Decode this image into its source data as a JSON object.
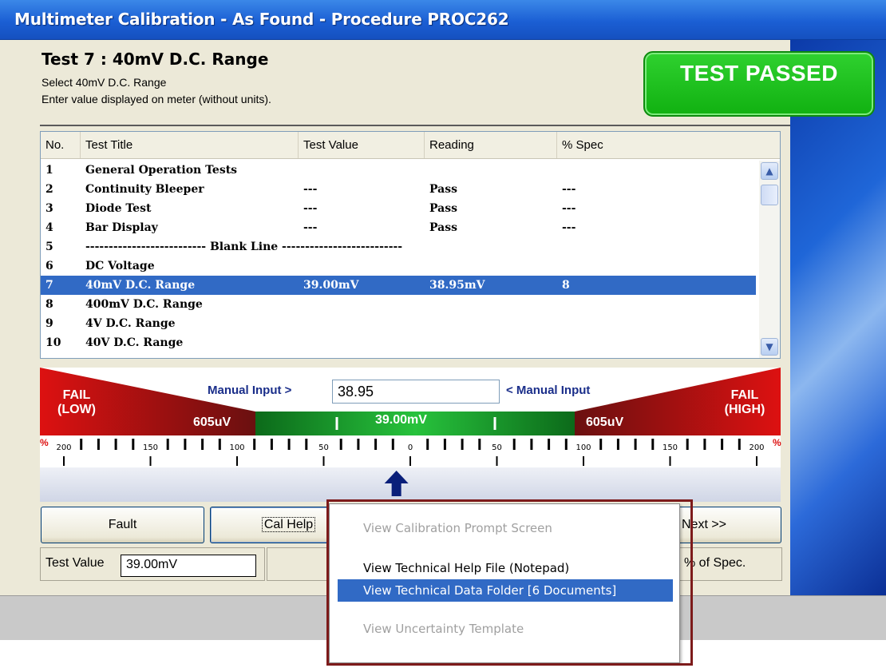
{
  "window": {
    "title": "Multimeter Calibration - As Found - Procedure PROC262"
  },
  "test": {
    "heading": "Test 7 : 40mV D.C. Range",
    "instruction1": "Select 40mV D.C. Range",
    "instruction2": "Enter value displayed on meter (without units).",
    "status": "TEST PASSED"
  },
  "table": {
    "headers": [
      "No.",
      "Test Title",
      "Test Value",
      "Reading",
      "% Spec"
    ],
    "rows": [
      {
        "no": "1",
        "title": "General Operation Tests",
        "value": "",
        "reading": "",
        "spec": ""
      },
      {
        "no": "2",
        "title": "Continuity Bleeper",
        "value": "---",
        "reading": "Pass",
        "spec": "---"
      },
      {
        "no": "3",
        "title": "Diode Test",
        "value": "---",
        "reading": "Pass",
        "spec": "---"
      },
      {
        "no": "4",
        "title": "Bar Display",
        "value": "---",
        "reading": "Pass",
        "spec": "---"
      },
      {
        "no": "5",
        "title": "-------------------------- Blank Line --------------------------",
        "value": "",
        "reading": "",
        "spec": ""
      },
      {
        "no": "6",
        "title": "DC Voltage",
        "value": "",
        "reading": "",
        "spec": ""
      },
      {
        "no": "7",
        "title": "40mV D.C. Range",
        "value": "39.00mV",
        "reading": "38.95mV",
        "spec": "8"
      },
      {
        "no": "8",
        "title": "400mV D.C. Range",
        "value": "",
        "reading": "",
        "spec": ""
      },
      {
        "no": "9",
        "title": "4V D.C. Range",
        "value": "",
        "reading": "",
        "spec": ""
      },
      {
        "no": "10",
        "title": "40V D.C. Range",
        "value": "",
        "reading": "",
        "spec": ""
      }
    ],
    "selected_index": 6
  },
  "gauge": {
    "fail_low_1": "FAIL",
    "fail_low_2": "(LOW)",
    "fail_high_1": "FAIL",
    "fail_high_2": "(HIGH)",
    "tol_low": "605uV",
    "tol_high": "605uV",
    "nominal": "39.00mV",
    "manual_input_left": "Manual Input >",
    "manual_input_right": "< Manual Input",
    "manual_input_value": "38.95",
    "scale_labels": [
      "200",
      "150",
      "100",
      "50",
      "0",
      "50",
      "100",
      "150",
      "200"
    ],
    "end_label_left": "%",
    "end_label_right": "%",
    "pointer_percent": -8
  },
  "buttons": {
    "fault": "Fault",
    "cal_help": "Cal Help",
    "next": "Next >>"
  },
  "status": {
    "test_value_label": "Test Value",
    "test_value": "39.00mV",
    "spec_label": "% of Spec."
  },
  "menu": {
    "items": [
      "View Calibration Prompt Screen",
      "View Technical Help File (Notepad)",
      "View Technical Data Folder [6 Documents]",
      "View Uncertainty Template"
    ]
  },
  "colors": {
    "title_bar": "#1b5fd4",
    "pass_green": "#11b111",
    "fail_red": "#cc1010",
    "selection": "#316ac5",
    "menu_outline": "#7d1b1b"
  }
}
